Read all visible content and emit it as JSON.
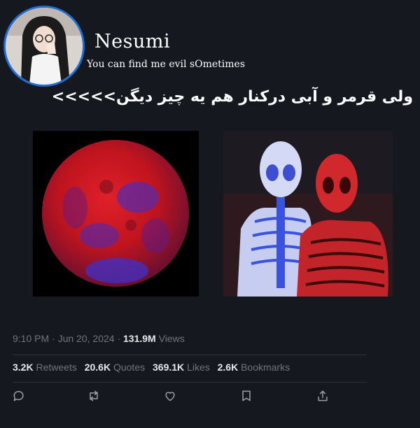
{
  "profile": {
    "display_name": "Nesumi",
    "bio": "You can find me evil sOmetimes",
    "accent": "#1d6fd6"
  },
  "tweet": {
    "text": "ولی قرمر و آبی درکنار هم یه چیز دیگن>>>>>"
  },
  "meta": {
    "time": "9:10 PM",
    "sep1": "·",
    "date": "Jun 20, 2024",
    "sep2": "·",
    "views_count": "131.9M",
    "views_label": "Views"
  },
  "stats": {
    "retweets_count": "3.2K",
    "retweets_label": "Retweets",
    "quotes_count": "20.6K",
    "quotes_label": "Quotes",
    "likes_count": "369.1K",
    "likes_label": "Likes",
    "bookmarks_count": "2.6K",
    "bookmarks_label": "Bookmarks"
  },
  "actions": [
    "reply-icon",
    "retweet-icon",
    "like-icon",
    "bookmark-icon",
    "share-icon"
  ],
  "colors": {
    "background": "#15181e",
    "muted": "#71767b",
    "text": "#e7e9ea",
    "divider": "#2f3336"
  }
}
